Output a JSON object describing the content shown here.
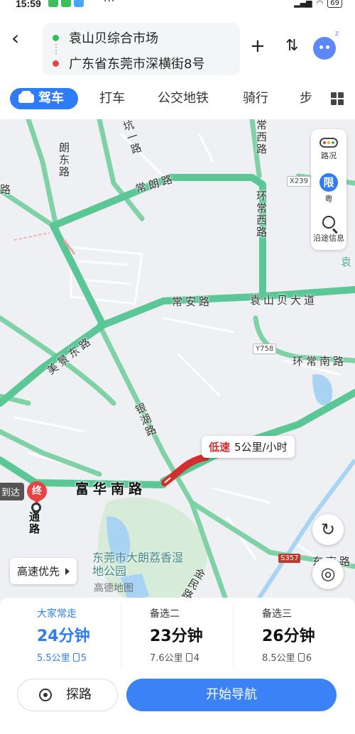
{
  "status_bar": {
    "time": "15:59",
    "dots": "···",
    "battery": "69"
  },
  "header": {
    "origin": "袁山贝综合市场",
    "destination": "广东省东莞市深横街8号",
    "add_label": "+",
    "swap_label": "⇅",
    "assistant_z": "z"
  },
  "tabs": [
    {
      "label": "驾车",
      "active": true
    },
    {
      "label": "打车"
    },
    {
      "label": "公交地铁"
    },
    {
      "label": "骑行"
    },
    {
      "label": "步"
    }
  ],
  "map": {
    "roads": {
      "changlang": "常朗路",
      "changan": "常安路",
      "yuanshanbei": "袁山贝大道",
      "huanchangxi": "环常西路",
      "huanchangnan": "环常南路",
      "meijingdong": "美景东路",
      "yinhu": "银湖路",
      "fuhuanan": "富华南路",
      "changxi": "常西路",
      "langdong": "朗东路",
      "kengyi": "坑一路",
      "tong": "通路",
      "jinmin": "金民路",
      "partial_left": "路",
      "partial_right": "袁",
      "partial_road2": "东南路"
    },
    "shields": {
      "x239": "X239",
      "y758": "Y758",
      "s357": "S357"
    },
    "park": "东莞市大朗荔香湿地公园",
    "watermark": "高德地图",
    "speed_tip": {
      "low": "低速",
      "value": "5公里/小时"
    },
    "side_panel": {
      "traffic": "路况",
      "limit": "限",
      "limit_sub": "粤",
      "along": "沿途信息"
    },
    "end_marker": "终",
    "arrive_tag": "到达",
    "pref_button": "高速优先",
    "refresh_glyph": "↻",
    "locate_glyph": "◎"
  },
  "routes": [
    {
      "title": "大家常走",
      "time": "24分钟",
      "distance": "5.5公里",
      "lights": "5"
    },
    {
      "title": "备选二",
      "time": "23分钟",
      "distance": "7.6公里",
      "lights": "4"
    },
    {
      "title": "备选三",
      "time": "26分钟",
      "distance": "8.5公里",
      "lights": "6"
    }
  ],
  "actions": {
    "explore": "探路",
    "start_nav": "开始导航"
  },
  "colors": {
    "accent": "#2e7cf6",
    "route_green": "#4cc48a",
    "congestion_red": "#d32f2f",
    "origin_dot": "#2fbf5b",
    "dest_dot": "#e84343"
  }
}
